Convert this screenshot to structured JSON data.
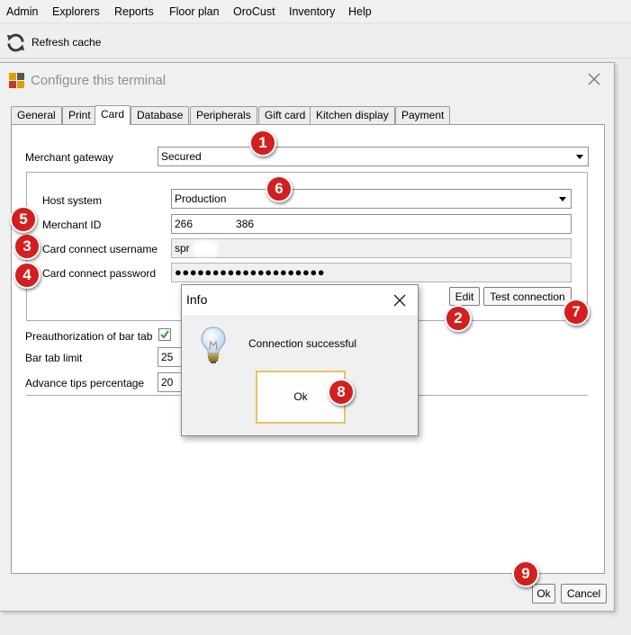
{
  "menubar": {
    "items": [
      "Admin",
      "Explorers",
      "Reports",
      "Floor plan",
      "OroCust",
      "Inventory",
      "Help"
    ]
  },
  "toolbar": {
    "refresh_label": "Refresh cache",
    "refresh_icon": "refresh-icon"
  },
  "dialog": {
    "title": "Configure this terminal",
    "tabs": [
      {
        "label": "General",
        "active": false
      },
      {
        "label": "Print",
        "active": false
      },
      {
        "label": "Card",
        "active": true
      },
      {
        "label": "Database",
        "active": false
      },
      {
        "label": "Peripherals",
        "active": false
      },
      {
        "label": "Gift card",
        "active": false
      },
      {
        "label": "Kitchen display",
        "active": false
      },
      {
        "label": "Payment",
        "active": false
      }
    ],
    "card": {
      "merchant_gateway_label": "Merchant gateway",
      "merchant_gateway_value": "Secured",
      "host_system_label": "Host system",
      "host_system_value": "Production",
      "merchant_id_label": "Merchant ID",
      "merchant_id_value_start": "266",
      "merchant_id_value_end": "386",
      "username_label": "Card connect username",
      "username_value": "spr",
      "password_label": "Card connect password",
      "password_value": "●●●●●●●●●●●●●●●●●●●●",
      "edit_button": "Edit",
      "test_button": "Test connection",
      "preauth_label": "Preauthorization of bar tab",
      "preauth_checked": true,
      "bar_tab_limit_label": "Bar tab limit",
      "bar_tab_limit_value": "25",
      "advance_tips_label": "Advance tips percentage",
      "advance_tips_value": "20"
    },
    "ok_button": "Ok",
    "cancel_button": "Cancel"
  },
  "info_popup": {
    "title": "Info",
    "message": "Connection successful",
    "ok_button": "Ok",
    "icon": "lightbulb-icon"
  },
  "callouts": [
    "1",
    "2",
    "3",
    "4",
    "5",
    "6",
    "7",
    "8",
    "9"
  ],
  "colors": {
    "callout": "#d21f1f",
    "check": "#2e9e3a",
    "ok_focus": "#e5c365"
  }
}
